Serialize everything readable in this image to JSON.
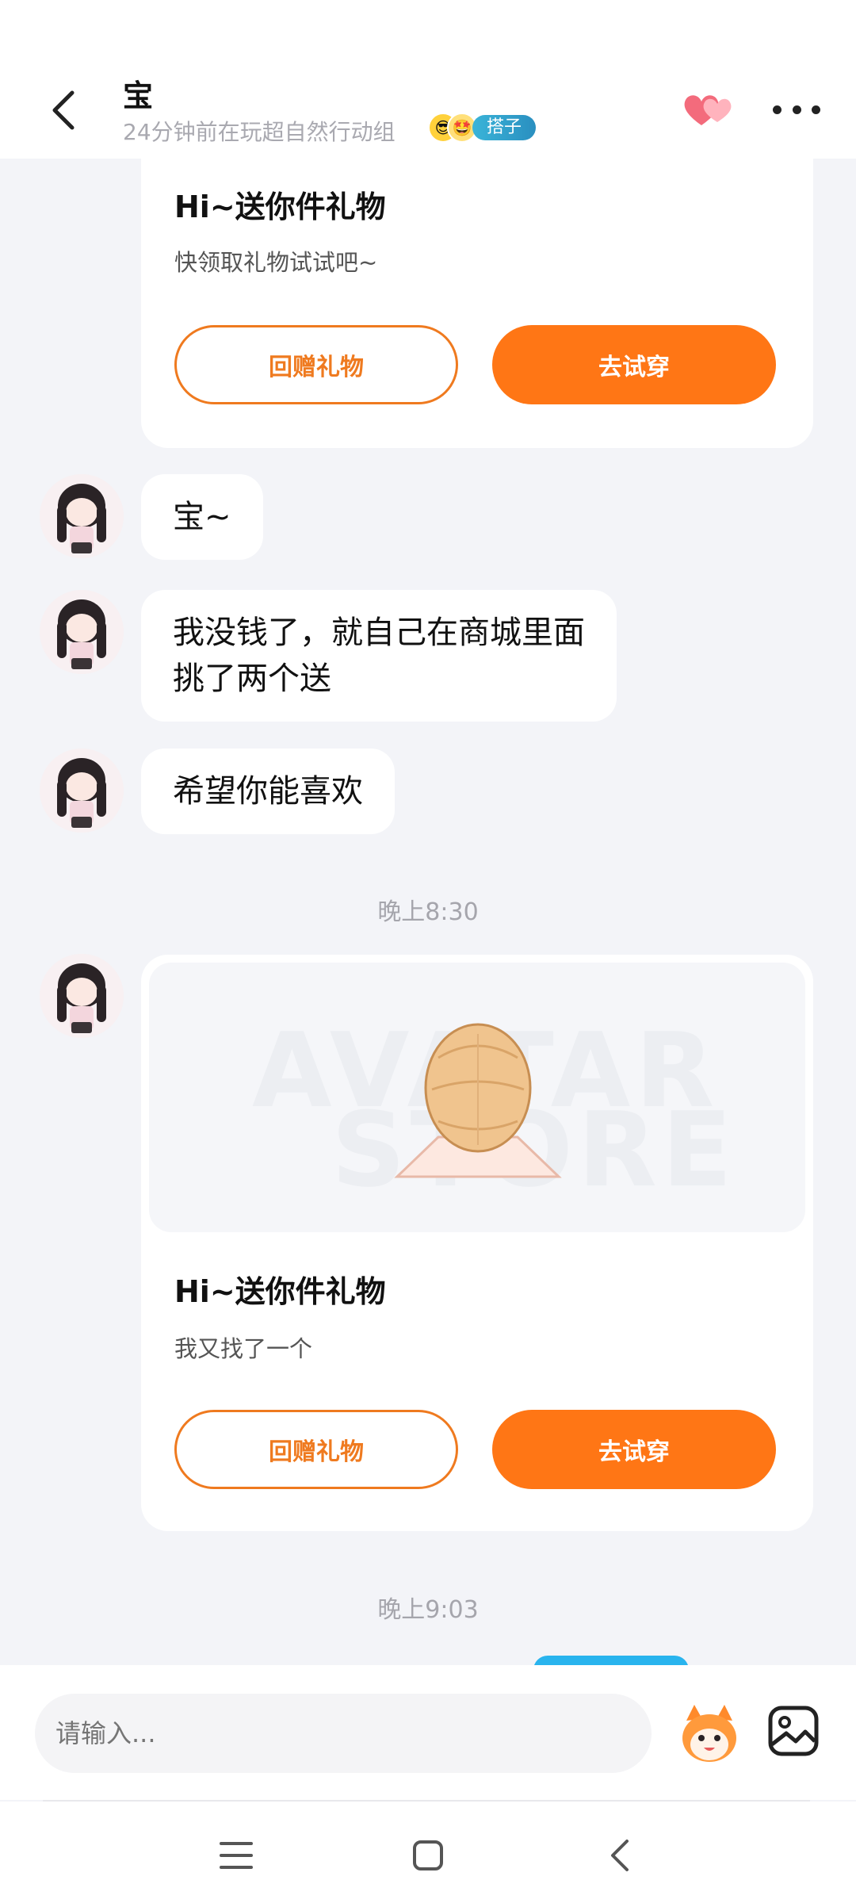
{
  "header": {
    "title": "宝",
    "subtitle": "24分钟前在玩超自然行动组",
    "tag": "搭子"
  },
  "messages": {
    "gift1": {
      "title": "Hi~送你件礼物",
      "desc": "快领取礼物试试吧~",
      "return_label": "回赠礼物",
      "try_label": "去试穿"
    },
    "bubble1": "宝~",
    "bubble2_line1": "我没钱了，就自己在商城里面",
    "bubble2_line2": "挑了两个送",
    "bubble3": "希望你能喜欢",
    "time1": "晚上8:30",
    "gift2": {
      "watermark_line1": "AVATAR",
      "watermark_line2": "STORE",
      "title": "Hi~送你件礼物",
      "desc": "我又找了一个",
      "return_label": "回赠礼物",
      "try_label": "去试穿"
    },
    "time2": "晚上9:03"
  },
  "input": {
    "placeholder": "请输入..."
  },
  "icons": {
    "back": "chevron-left-icon",
    "hearts": "hearts-icon",
    "more": "more-icon",
    "sticker": "sticker-mascot-icon",
    "image": "image-icon",
    "nav_menu": "menu-icon",
    "nav_home": "home-icon",
    "nav_back": "back-icon"
  },
  "colors": {
    "accent_orange": "#ff7615",
    "outline_orange": "#ef7a1f",
    "tag_blue": "#2a8fc0",
    "bubble_blue": "#29b4ee"
  }
}
